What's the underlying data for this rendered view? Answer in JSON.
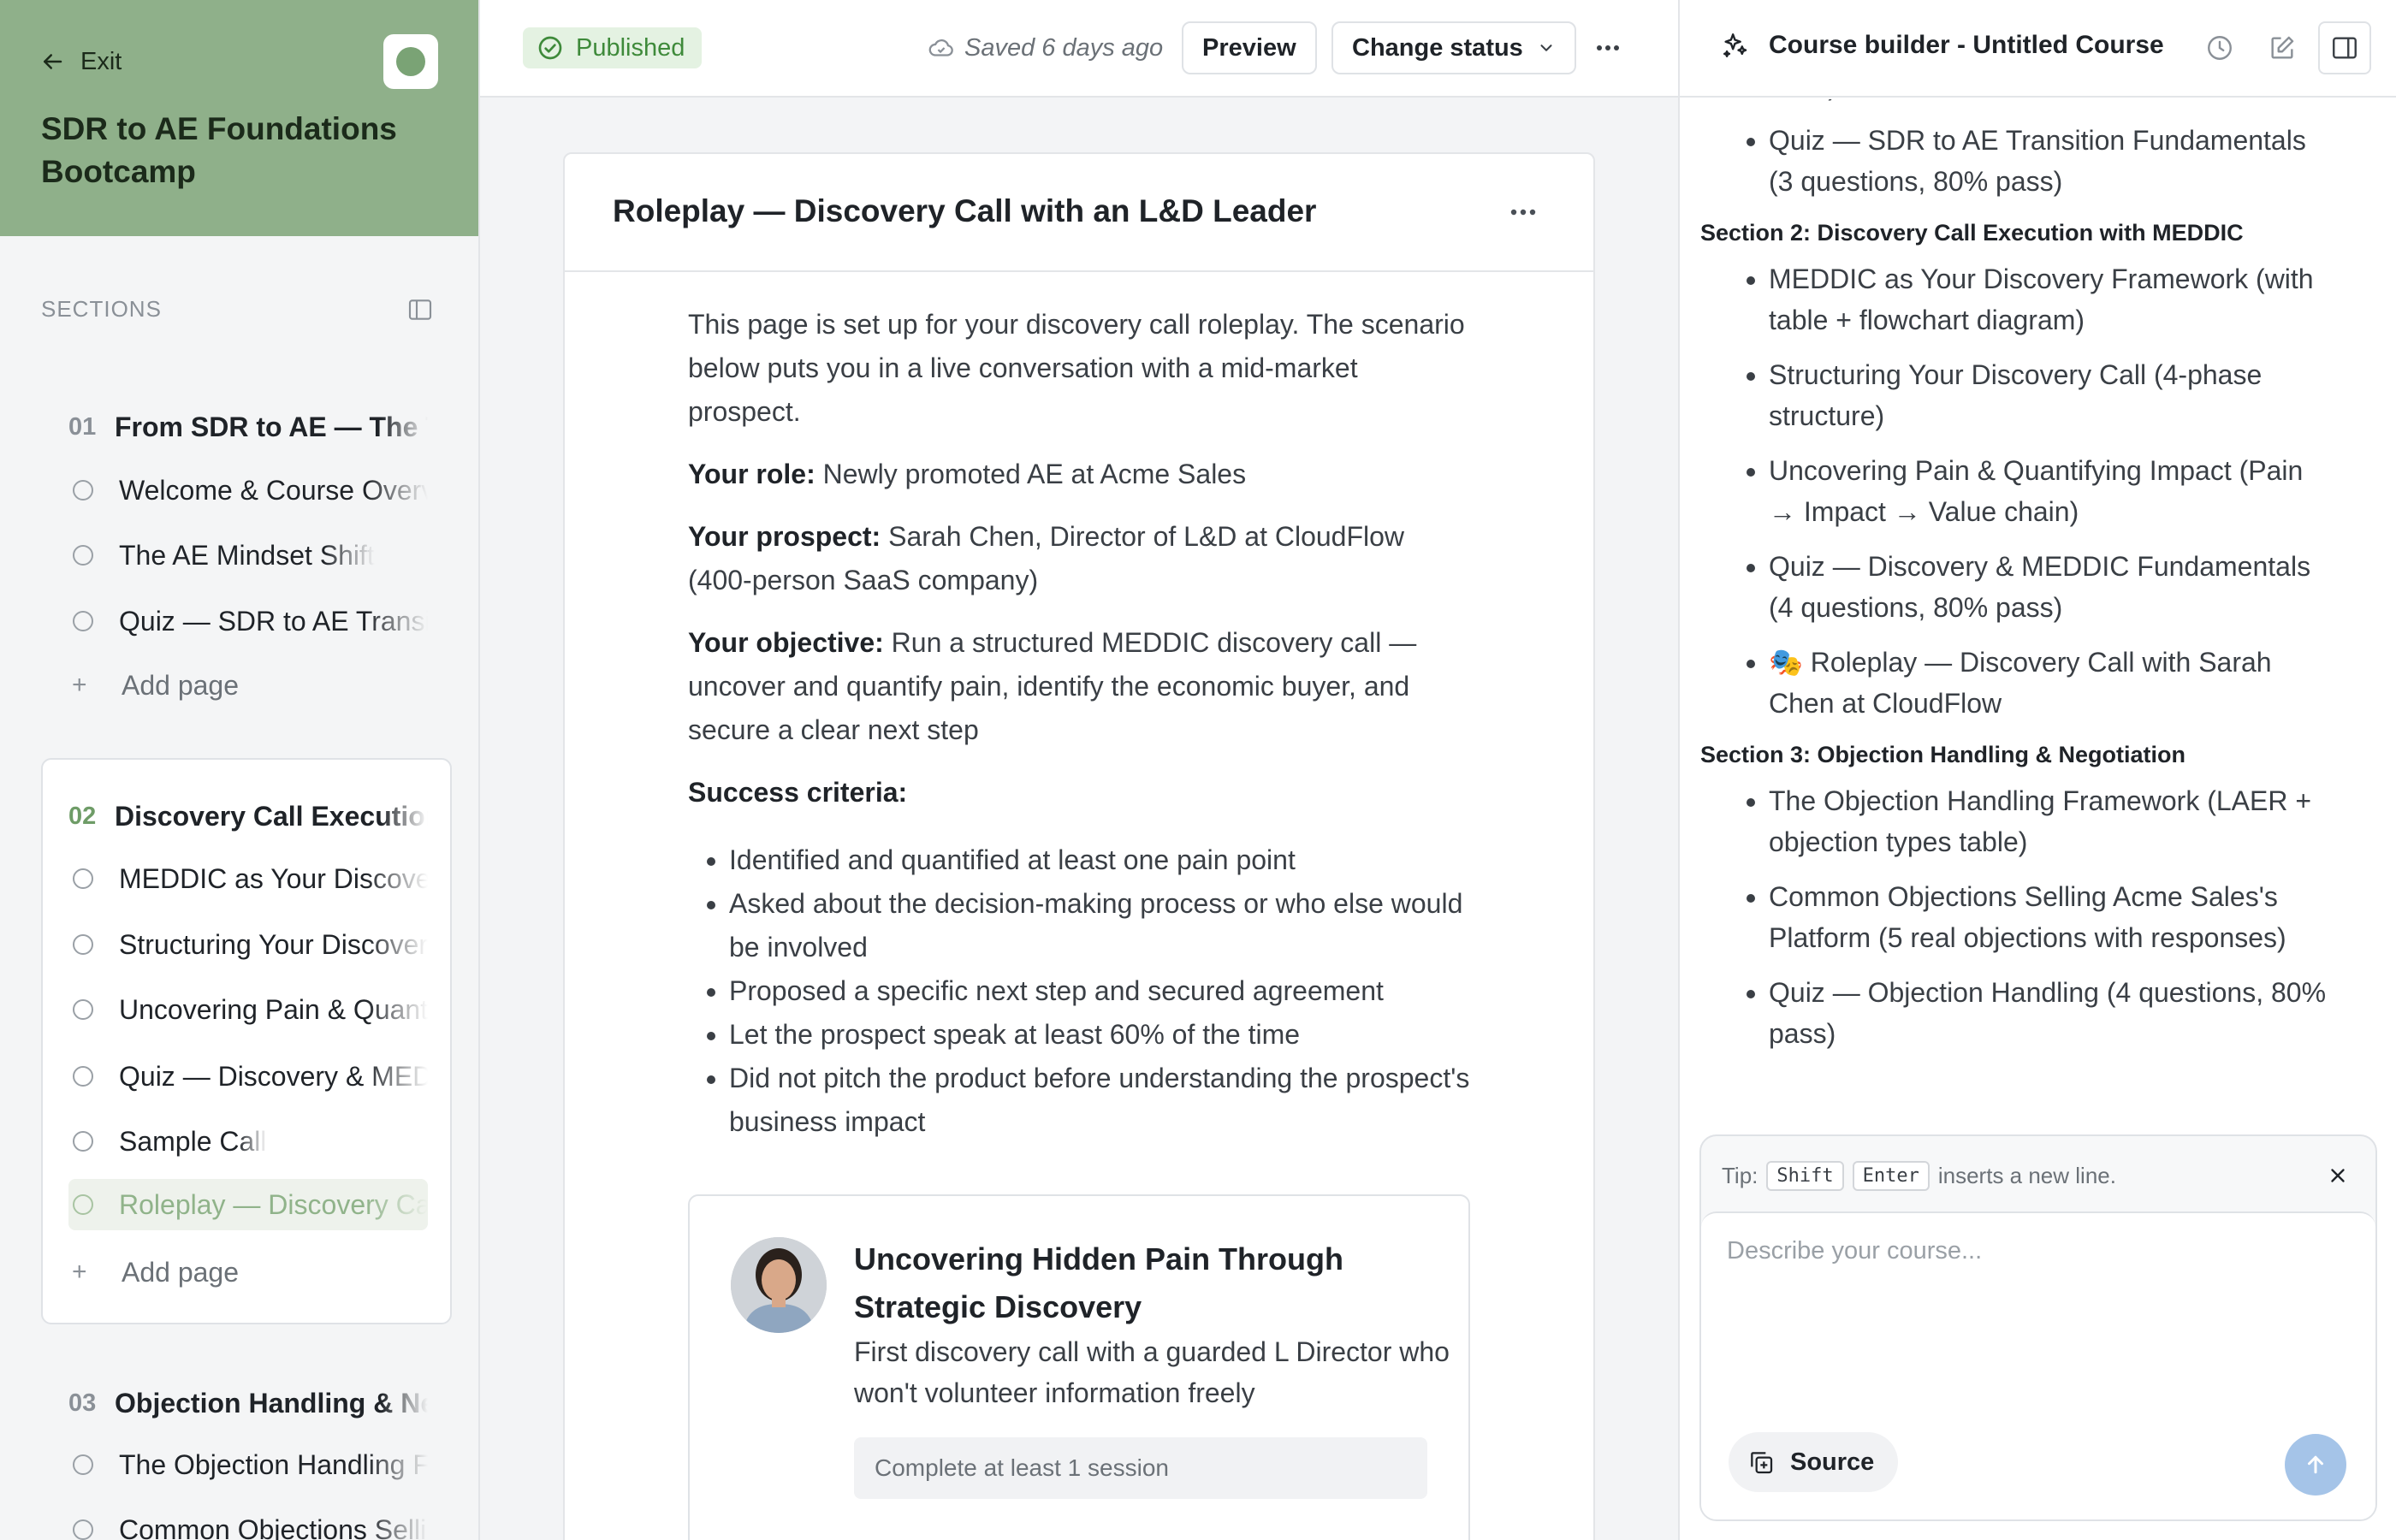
{
  "sidebar": {
    "exit_label": "Exit",
    "course_title": "SDR to AE Foundations Bootcamp",
    "sections_label": "SECTIONS",
    "add_page_label": "Add page",
    "sections": [
      {
        "num": "01",
        "title": "From SDR to AE — The Transition",
        "pages": [
          "Welcome & Course Overview",
          "The AE Mindset Shift",
          "Quiz — SDR to AE Transition Fundamentals"
        ]
      },
      {
        "num": "02",
        "title": "Discovery Call Execution with MEDDIC",
        "pages": [
          "MEDDIC as Your Discovery Framework",
          "Structuring Your Discovery Call",
          "Uncovering Pain & Quantifying Impact",
          "Quiz — Discovery & MEDDIC Fundamentals",
          "Sample Call",
          "Roleplay — Discovery Call with Sarah Chen"
        ]
      },
      {
        "num": "03",
        "title": "Objection Handling & Negotiation",
        "pages": [
          "The Objection Handling Framework",
          "Common Objections Selling Acme Sales's Platform"
        ]
      }
    ]
  },
  "topbar": {
    "status": "Published",
    "saved": "Saved 6 days ago",
    "preview_label": "Preview",
    "change_status_label": "Change status"
  },
  "doc": {
    "title": "Roleplay — Discovery Call with an L&D Leader",
    "intro": "This page is set up for your discovery call roleplay. The scenario below puts you in a live conversation with a mid-market prospect.",
    "role_label": "Your role:",
    "role_value": " Newly promoted AE at Acme Sales",
    "prospect_label": "Your prospect:",
    "prospect_value": " Sarah Chen, Director of L&D at CloudFlow (400-person SaaS company)",
    "objective_label": "Your objective:",
    "objective_value": " Run a structured MEDDIC discovery call — uncover and quantify pain, identify the economic buyer, and secure a clear next step",
    "criteria_label": "Success criteria:",
    "criteria": [
      "Identified and quantified at least one pain point",
      "Asked about the decision-making process or who else would be involved",
      "Proposed a specific next step and secured agreement",
      "Let the prospect speak at least 60% of the time",
      "Did not pitch the product before understanding the prospect's business impact"
    ],
    "roleplay": {
      "title": "Uncovering Hidden Pain Through Strategic Discovery",
      "description": "First discovery call with a guarded L Director who won't volunteer information freely",
      "progress": "Complete at least 1 session"
    }
  },
  "builder": {
    "heading": "Course builder - Untitled Course",
    "outline_top_fragment": "table)",
    "items_a": [
      "Quiz — SDR to AE Transition Fundamentals (3 questions, 80% pass)"
    ],
    "section2": "Section 2: Discovery Call Execution with MEDDIC",
    "items_b": [
      "MEDDIC as Your Discovery Framework (with table + flowchart diagram)",
      "Structuring Your Discovery Call (4-phase structure)",
      "Uncovering Pain & Quantifying Impact (Pain → Impact → Value chain)",
      "Quiz — Discovery & MEDDIC Fundamentals (4 questions, 80% pass)",
      "🎭 Roleplay — Discovery Call with Sarah Chen at CloudFlow"
    ],
    "section3": "Section 3: Objection Handling & Negotiation",
    "items_c": [
      "The Objection Handling Framework (LAER + objection types table)",
      "Common Objections Selling Acme Sales's Platform (5 real objections with responses)",
      "Quiz — Objection Handling (4 questions, 80% pass)"
    ],
    "tip_prefix": "Tip:",
    "tip_key1": "Shift",
    "tip_key2": "Enter",
    "tip_suffix": "inserts a new line.",
    "input_placeholder": "Describe your course...",
    "source_label": "Source"
  },
  "colors": {
    "sidebar_header": "#8fb08a",
    "published_bg": "#e4f2e2",
    "published_text": "#3e8a3a",
    "send_button": "#a5c4e8"
  }
}
